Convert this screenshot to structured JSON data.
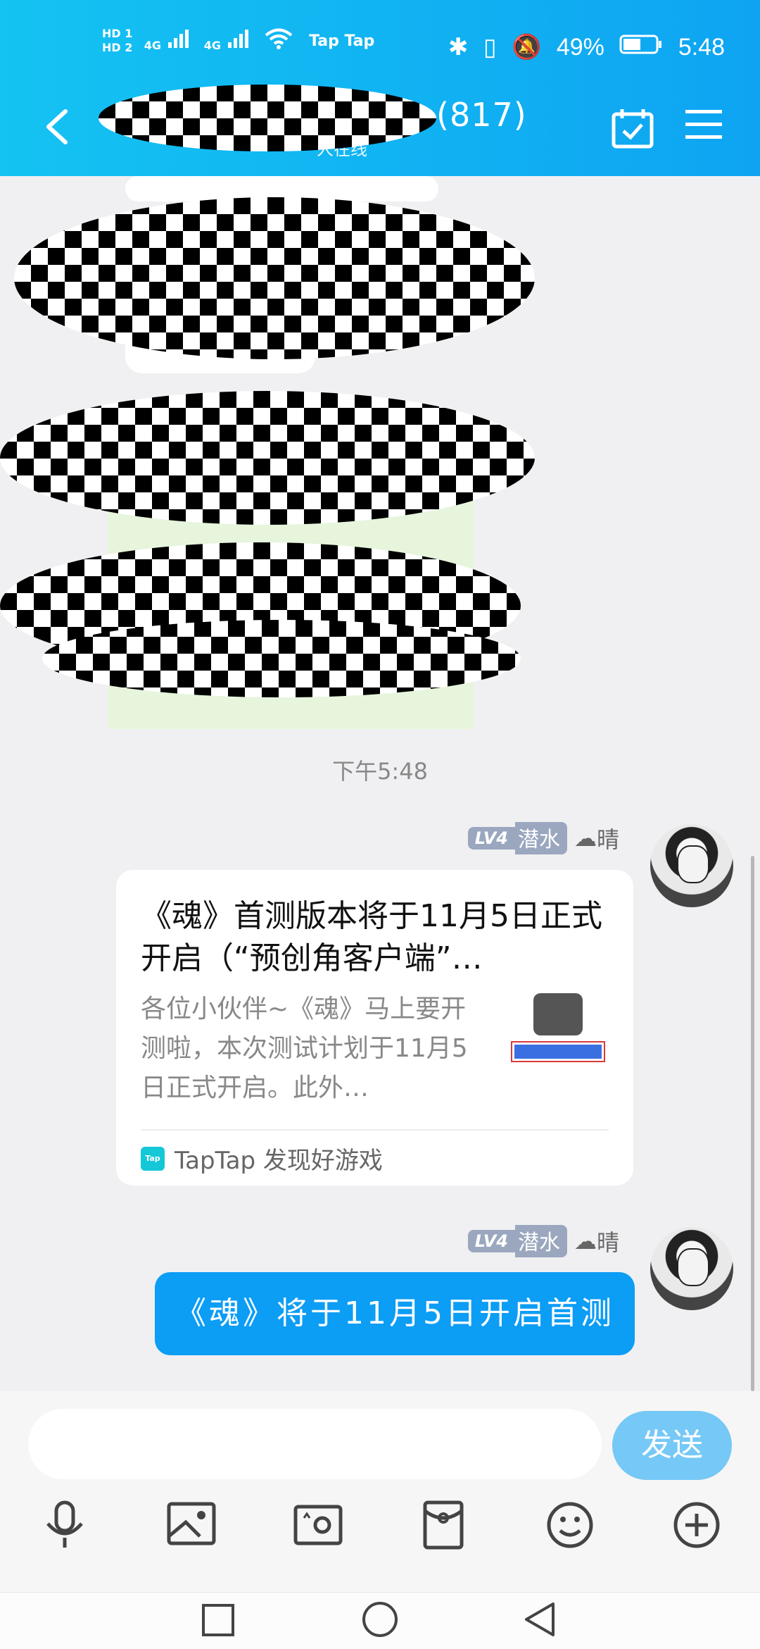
{
  "status_bar": {
    "hd1": "HD 1",
    "hd2": "HD 2",
    "net1": "4G",
    "net2": "4G",
    "carrier": "Tap Tap",
    "battery": "49%",
    "time": "5:48"
  },
  "header": {
    "title": "(817)",
    "subtitle": "人在线"
  },
  "chat": {
    "timestamp": "下午5:48",
    "messages": [
      {
        "level": "LV4",
        "rank": "潜水",
        "mood": "晴",
        "card": {
          "title": "《魂》首测版本将于11月5日正式开启（“预创角客户端”…",
          "description": "各位小伙伴~《魂》马上要开测啦，本次测试计划于11月5日正式开启。此外…",
          "source_badge": "Tap",
          "source": "TapTap 发现好游戏"
        }
      },
      {
        "level": "LV4",
        "rank": "潜水",
        "mood": "晴",
        "text": "《魂》将于11月5日开启首测"
      }
    ]
  },
  "composer": {
    "input_value": "",
    "send_label": "发送"
  },
  "toolbar_icons": [
    "microphone-icon",
    "image-icon",
    "camera-icon",
    "red-packet-icon",
    "emoji-icon",
    "plus-icon"
  ],
  "colors": {
    "header_start": "#14c3f2",
    "header_end": "#0ea4f2",
    "bubble": "#0c9df5",
    "send": "#76c8f6"
  }
}
